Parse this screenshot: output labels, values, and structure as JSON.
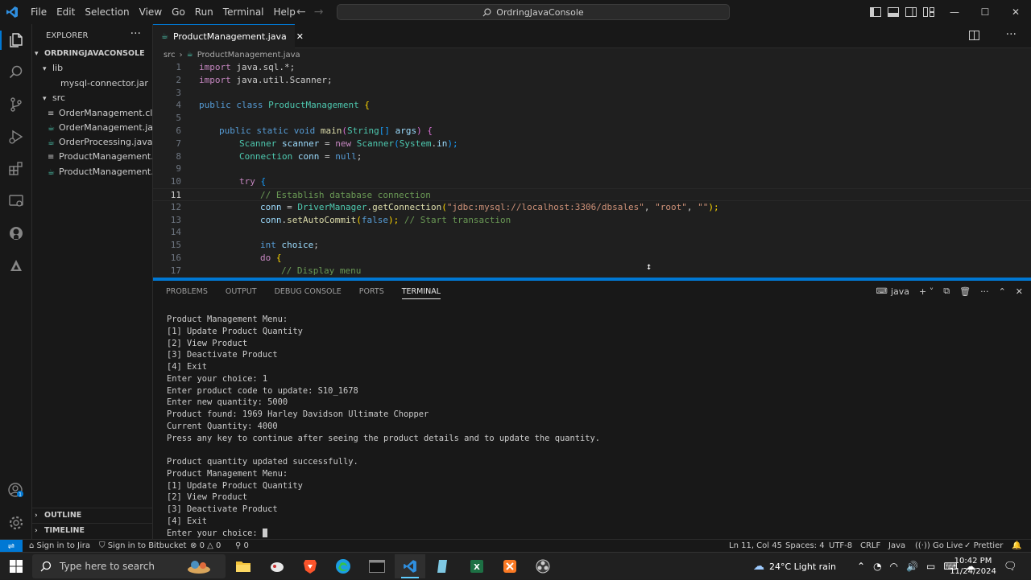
{
  "menu": [
    "File",
    "Edit",
    "Selection",
    "View",
    "Go",
    "Run",
    "Terminal",
    "Help"
  ],
  "search": {
    "label": "OrdringJavaConsole"
  },
  "sidebar": {
    "header": "EXPLORER",
    "project": "ORDRINGJAVACONSOLE",
    "items": [
      {
        "label": "lib",
        "type": "folder"
      },
      {
        "label": "mysql-connector.jar",
        "type": "jar"
      },
      {
        "label": "src",
        "type": "folder"
      },
      {
        "label": "OrderManagement.cl...",
        "type": "class"
      },
      {
        "label": "OrderManagement.java",
        "type": "java"
      },
      {
        "label": "OrderProcessing.java",
        "type": "java"
      },
      {
        "label": "ProductManagement....",
        "type": "class"
      },
      {
        "label": "ProductManagement.j...",
        "type": "java"
      }
    ],
    "outline": "OUTLINE",
    "timeline": "TIMELINE"
  },
  "editor": {
    "tab_label": "ProductManagement.java",
    "breadcrumb_folder": "src",
    "breadcrumb_file": "ProductManagement.java",
    "line_numbers": [
      "1",
      "2",
      "3",
      "4",
      "5",
      "6",
      "7",
      "8",
      "9",
      "10",
      "11",
      "12",
      "13",
      "14",
      "15",
      "16",
      "17"
    ],
    "code": {
      "l1": [
        "import",
        " java.sql.*;"
      ],
      "l2": [
        "import",
        " java.util.Scanner;"
      ],
      "l4": [
        "public",
        " ",
        "class",
        " ",
        "ProductManagement",
        " {"
      ],
      "l6": [
        "public",
        " ",
        "static",
        " ",
        "void",
        " ",
        "main",
        "(",
        "String",
        "[] ",
        "args",
        ") {"
      ],
      "l7": [
        "Scanner",
        " ",
        "scanner",
        " = ",
        "new",
        " ",
        "Scanner",
        "(",
        "System",
        ".",
        "in",
        ");"
      ],
      "l8": [
        "Connection",
        " ",
        "conn",
        " = ",
        "null",
        ";"
      ],
      "l10": [
        "try",
        " {"
      ],
      "l11": "// Establish database connection",
      "l12": [
        "conn",
        " = ",
        "DriverManager",
        ".",
        "getConnection",
        "(",
        "\"jdbc:mysql://localhost:3306/dbsales\"",
        ", ",
        "\"root\"",
        ", ",
        "\"\"",
        ");"
      ],
      "l13": [
        "conn",
        ".",
        "setAutoCommit",
        "(",
        "false",
        "); ",
        "// Start transaction"
      ],
      "l15": [
        "int",
        " ",
        "choice",
        ";"
      ],
      "l16": [
        "do",
        " {"
      ],
      "l17": "// Display menu"
    }
  },
  "panel": {
    "tabs": [
      "PROBLEMS",
      "OUTPUT",
      "DEBUG CONSOLE",
      "PORTS",
      "TERMINAL"
    ],
    "active_tab": "TERMINAL",
    "terminal_name": "java",
    "terminal_lines": [
      "Product Management Menu:",
      "[1] Update Product Quantity",
      "[2] View Product",
      "[3] Deactivate Product",
      "[4] Exit",
      "Enter your choice: 1",
      "Enter product code to update: S10_1678",
      "Enter new quantity: 5000",
      "Product found: 1969 Harley Davidson Ultimate Chopper",
      "Current Quantity: 4000",
      "Press any key to continue after seeing the product details and to update the quantity.",
      "",
      "Product quantity updated successfully.",
      "Product Management Menu:",
      "[1] Update Product Quantity",
      "[2] View Product",
      "[3] Deactivate Product",
      "[4] Exit",
      "Enter your choice: "
    ]
  },
  "status": {
    "jira": "Sign in to Jira",
    "bitbucket": "Sign in to Bitbucket",
    "errors": "0",
    "warnings": "0",
    "ports": "0",
    "position": "Ln 11, Col 45",
    "spaces": "Spaces: 4",
    "encoding": "UTF-8",
    "eol": "CRLF",
    "language": "Java",
    "golive": "Go Live",
    "prettier": "Prettier"
  },
  "taskbar": {
    "search_placeholder": "Type here to search",
    "weather": "24°C  Light rain",
    "time": "10:42 PM",
    "date": "11/24/2024"
  },
  "colors": {
    "accent": "#0078d4",
    "background": "#1f1f1f",
    "sidebar": "#181818"
  }
}
